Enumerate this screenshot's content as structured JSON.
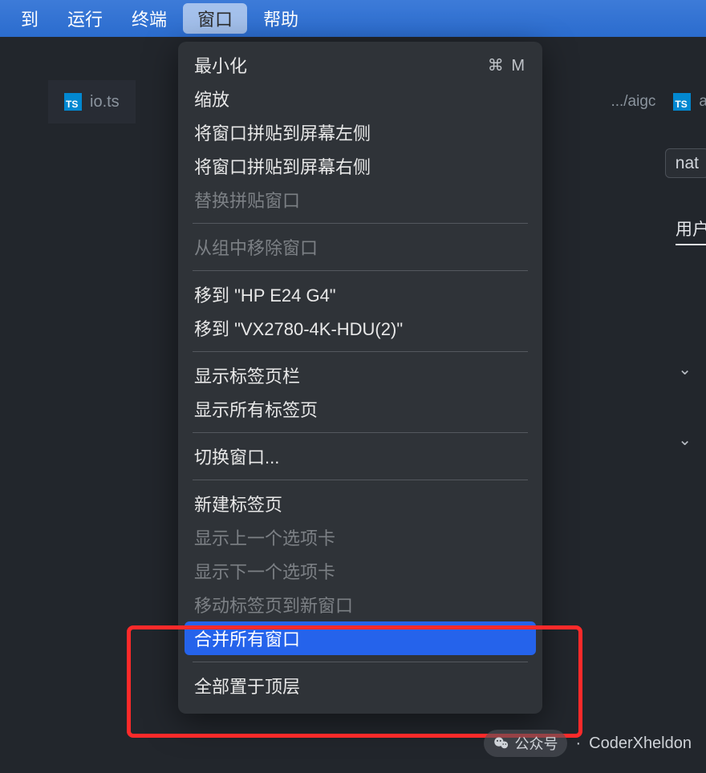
{
  "menubar": {
    "items": [
      {
        "label": "到"
      },
      {
        "label": "运行"
      },
      {
        "label": "终端"
      },
      {
        "label": "窗口",
        "active": true
      },
      {
        "label": "帮助"
      }
    ]
  },
  "tabs": {
    "left": {
      "filename": "io.ts",
      "icon_label": "TS"
    },
    "right_breadcrumb": ".../aigc",
    "right_file_prefix": "a",
    "right_icon_label": "TS"
  },
  "dropdown": {
    "groups": [
      [
        {
          "label": "最小化",
          "shortcut": "⌘ M"
        },
        {
          "label": "缩放"
        },
        {
          "label": "将窗口拼贴到屏幕左侧"
        },
        {
          "label": "将窗口拼贴到屏幕右侧"
        },
        {
          "label": "替换拼贴窗口",
          "disabled": true
        }
      ],
      [
        {
          "label": "从组中移除窗口",
          "disabled": true
        }
      ],
      [
        {
          "label": "移到 \"HP E24 G4\""
        },
        {
          "label": "移到 \"VX2780-4K-HDU(2)\""
        }
      ],
      [
        {
          "label": "显示标签页栏"
        },
        {
          "label": "显示所有标签页"
        }
      ],
      [
        {
          "label": "切换窗口..."
        }
      ],
      [
        {
          "label": "新建标签页"
        },
        {
          "label": "显示上一个选项卡",
          "disabled": true
        },
        {
          "label": "显示下一个选项卡",
          "disabled": true
        },
        {
          "label": "移动标签页到新窗口",
          "disabled": true
        },
        {
          "label": "合并所有窗口",
          "highlight": true
        }
      ],
      [
        {
          "label": "全部置于顶层"
        }
      ]
    ]
  },
  "right_panel": {
    "chip_text": "nat",
    "tab_text": "用户",
    "chevrons": [
      "⌄",
      "⌄"
    ]
  },
  "footer": {
    "badge_label": "公众号",
    "separator": "·",
    "author": "CoderXheldon"
  }
}
